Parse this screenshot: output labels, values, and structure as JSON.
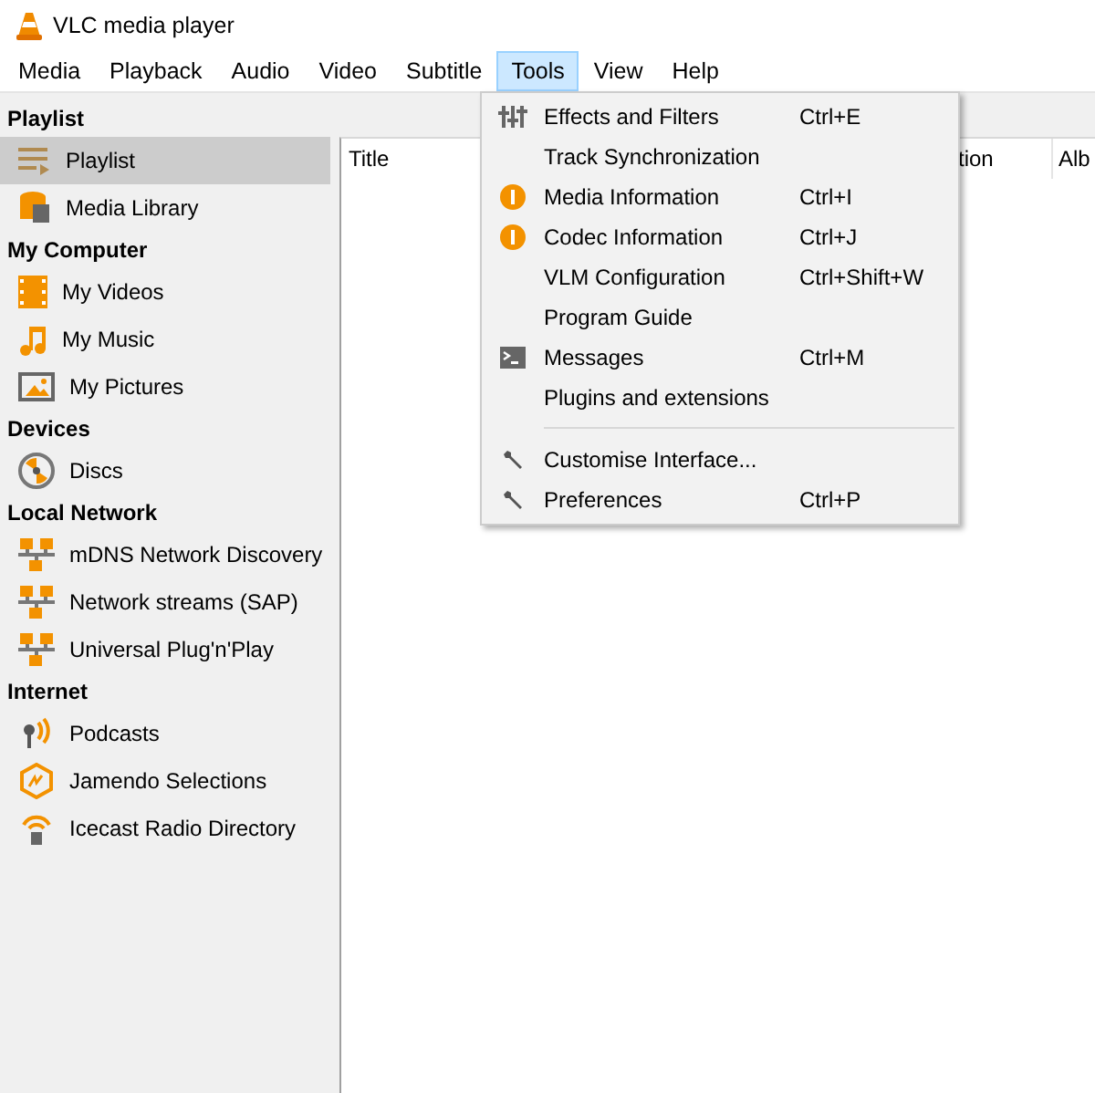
{
  "window": {
    "title": "VLC media player"
  },
  "menu_bar": [
    {
      "label": "Media",
      "selected": false
    },
    {
      "label": "Playback",
      "selected": false
    },
    {
      "label": "Audio",
      "selected": false
    },
    {
      "label": "Video",
      "selected": false
    },
    {
      "label": "Subtitle",
      "selected": false
    },
    {
      "label": "Tools",
      "selected": true
    },
    {
      "label": "View",
      "selected": false
    },
    {
      "label": "Help",
      "selected": false
    }
  ],
  "sidebar": [
    {
      "heading": "Playlist",
      "items": [
        {
          "label": "Playlist",
          "selected": true
        },
        {
          "label": "Media Library",
          "selected": false
        }
      ]
    },
    {
      "heading": "My Computer",
      "items": [
        {
          "label": "My Videos",
          "selected": false
        },
        {
          "label": "My Music",
          "selected": false
        },
        {
          "label": "My Pictures",
          "selected": false
        }
      ]
    },
    {
      "heading": "Devices",
      "items": [
        {
          "label": "Discs",
          "selected": false
        }
      ]
    },
    {
      "heading": "Local Network",
      "items": [
        {
          "label": "mDNS Network Discovery",
          "selected": false
        },
        {
          "label": "Network streams (SAP)",
          "selected": false
        },
        {
          "label": "Universal Plug'n'Play",
          "selected": false
        }
      ]
    },
    {
      "heading": "Internet",
      "items": [
        {
          "label": "Podcasts",
          "selected": false
        },
        {
          "label": "Jamendo Selections",
          "selected": false
        },
        {
          "label": "Icecast Radio Directory",
          "selected": false
        }
      ]
    }
  ],
  "playlist": {
    "columns": [
      "Title",
      "tion",
      "Alb"
    ]
  },
  "tools_menu": [
    {
      "kind": "item",
      "label": "Effects and Filters",
      "shortcut": "Ctrl+E"
    },
    {
      "kind": "item",
      "label": "Track Synchronization"
    },
    {
      "kind": "item",
      "label": "Media Information",
      "shortcut": "Ctrl+I"
    },
    {
      "kind": "item",
      "label": "Codec Information",
      "shortcut": "Ctrl+J"
    },
    {
      "kind": "item",
      "label": "VLM Configuration",
      "shortcut": "Ctrl+Shift+W"
    },
    {
      "kind": "item",
      "label": "Program Guide"
    },
    {
      "kind": "item",
      "label": "Messages",
      "shortcut": "Ctrl+M"
    },
    {
      "kind": "item",
      "label": "Plugins and extensions"
    },
    {
      "kind": "separator"
    },
    {
      "kind": "item",
      "label": "Customise Interface..."
    },
    {
      "kind": "item",
      "label": "Preferences",
      "shortcut": "Ctrl+P"
    }
  ]
}
